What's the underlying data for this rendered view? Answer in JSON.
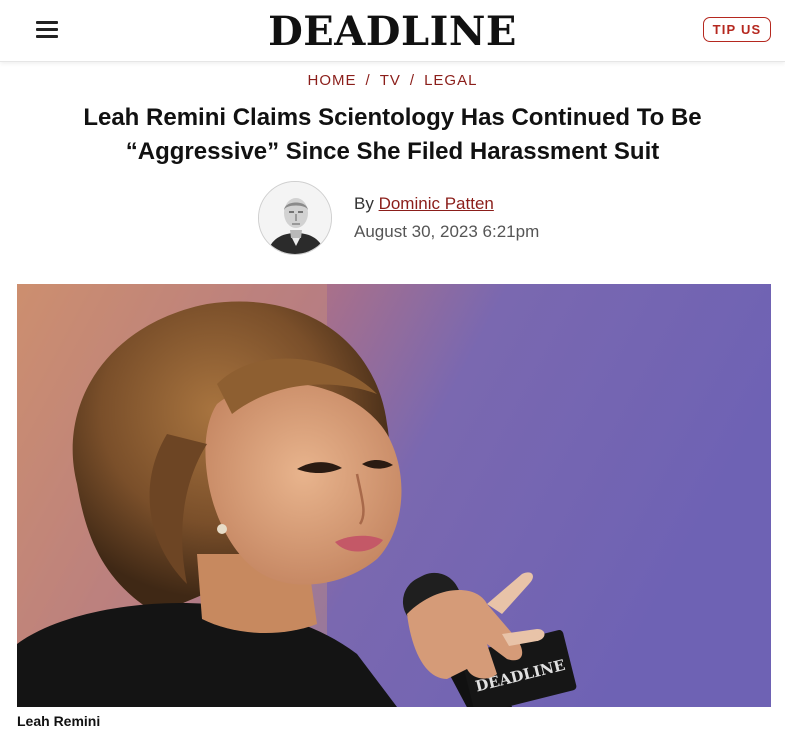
{
  "header": {
    "logo": "DEADLINE",
    "tip_button": "TIP US"
  },
  "breadcrumb": {
    "items": [
      "HOME",
      "TV",
      "LEGAL"
    ],
    "separator": "/"
  },
  "article": {
    "title_line1": "Leah Remini Claims Scientology Has Continued To Be",
    "title_line2": "“Aggressive” Since She Filed Harassment Suit",
    "by_label": "By",
    "author": "Dominic Patten",
    "date": "August 30, 2023 6:21pm"
  },
  "hero": {
    "mic_brand": "DEADLINE",
    "caption": "Leah Remini"
  },
  "colors": {
    "accent": "#8b1e1a",
    "tip": "#b5281f"
  }
}
